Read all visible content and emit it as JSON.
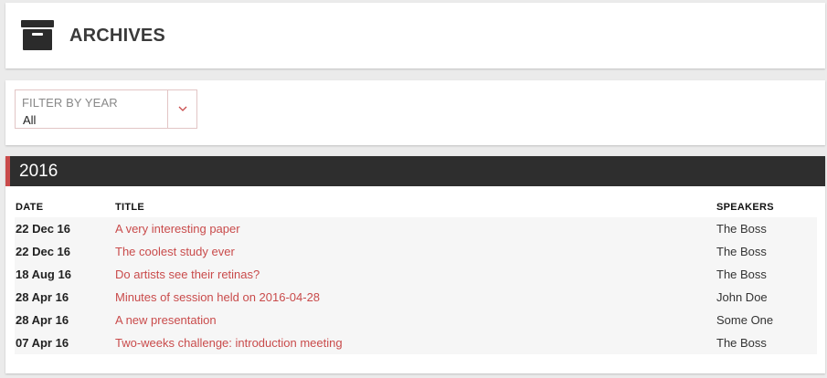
{
  "header": {
    "title": "ARCHIVES",
    "icon": "archive-box-icon"
  },
  "filter": {
    "label": "FILTER BY YEAR",
    "value": "All",
    "icon": "chevron-down-icon"
  },
  "archive": {
    "year": "2016",
    "columns": {
      "date": "DATE",
      "title": "TITLE",
      "speakers": "SPEAKERS"
    },
    "rows": [
      {
        "date": "22 Dec 16",
        "title": "A very interesting paper",
        "speaker": "The Boss"
      },
      {
        "date": "22 Dec 16",
        "title": "The coolest study ever",
        "speaker": "The Boss"
      },
      {
        "date": "18 Aug 16",
        "title": "Do artists see their retinas?",
        "speaker": "The Boss"
      },
      {
        "date": "28 Apr 16",
        "title": "Minutes of session held on 2016-04-28",
        "speaker": "John Doe"
      },
      {
        "date": "28 Apr 16",
        "title": "A new presentation",
        "speaker": "Some One"
      },
      {
        "date": "07 Apr 16",
        "title": "Two-weeks challenge: introduction meeting",
        "speaker": "The Boss"
      }
    ]
  },
  "colors": {
    "accent": "#c94b4b",
    "year_bar": "#2e2e2e",
    "background": "#ebebeb"
  }
}
